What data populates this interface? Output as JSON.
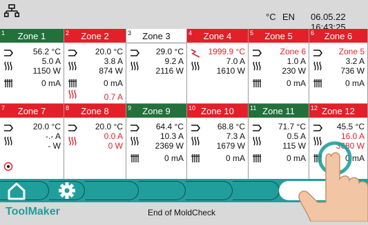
{
  "header": {
    "temp_unit": "°C",
    "language": "EN",
    "datetime": "06.05.22 16:43:25",
    "network_icon": "network-icon"
  },
  "zones_row1": [
    {
      "num": "1",
      "name": "Zone 1",
      "color": "green",
      "temp": "56.2 °C",
      "current": "5.0 A",
      "power": "1150 W",
      "ma": "0 mA"
    },
    {
      "num": "2",
      "name": "Zone 2",
      "color": "red",
      "temp": "20.0 °C",
      "current": "3.8 A",
      "power": "874 W",
      "ma": "0 mA",
      "extra": "0.7 A"
    },
    {
      "num": "3",
      "name": "Zone 3",
      "color": "white",
      "temp": "29.0 °C",
      "current": "9.2 A",
      "power": "2116 W"
    },
    {
      "num": "4",
      "name": "Zone 4",
      "color": "red",
      "temp": "1999.9 °C",
      "current": "7.0 A",
      "power": "1610 W"
    },
    {
      "num": "5",
      "name": "Zone 5",
      "color": "red",
      "temp": "Zone 6",
      "current": "1.0 A",
      "power": "230 W",
      "ma": "0 mA"
    },
    {
      "num": "6",
      "name": "Zone 6",
      "color": "red",
      "temp": "Zone 5",
      "current": "3.2 A",
      "power": "736 W",
      "ma": "0 mA"
    }
  ],
  "zones_row2": [
    {
      "num": "7",
      "name": "Zone 7",
      "color": "red",
      "temp": "20.0 °C",
      "current": "-.- A",
      "power": "- W"
    },
    {
      "num": "8",
      "name": "Zone 8",
      "color": "red",
      "temp": "20.0 °C",
      "current": "0.0 A",
      "power": "0 W"
    },
    {
      "num": "9",
      "name": "Zone 9",
      "color": "green",
      "temp": "64.4 °C",
      "current": "10.3 A",
      "power": "2369 W",
      "ma": "0 mA"
    },
    {
      "num": "10",
      "name": "Zone 10",
      "color": "red",
      "temp": "68.8 °C",
      "current": "7.3 A",
      "power": "1679 W",
      "ma": "0 mA"
    },
    {
      "num": "11",
      "name": "Zone 11",
      "color": "green",
      "temp": "71.7 °C",
      "current": "0.5 A",
      "power": "115 W",
      "ma": "0 mA"
    },
    {
      "num": "12",
      "name": "Zone 12",
      "color": "red",
      "temp": "45.5 °C",
      "current": "16.0 A",
      "power": "3680 W",
      "ma": "0 mA"
    }
  ],
  "nav": {
    "home": "home-icon",
    "settings": "gear-icon"
  },
  "footer": {
    "brand": "ToolMaker",
    "status": "End of MoldCheck"
  },
  "colors": {
    "red": "#e2202a",
    "green": "#23703b",
    "teal": "#1f9e9c"
  }
}
